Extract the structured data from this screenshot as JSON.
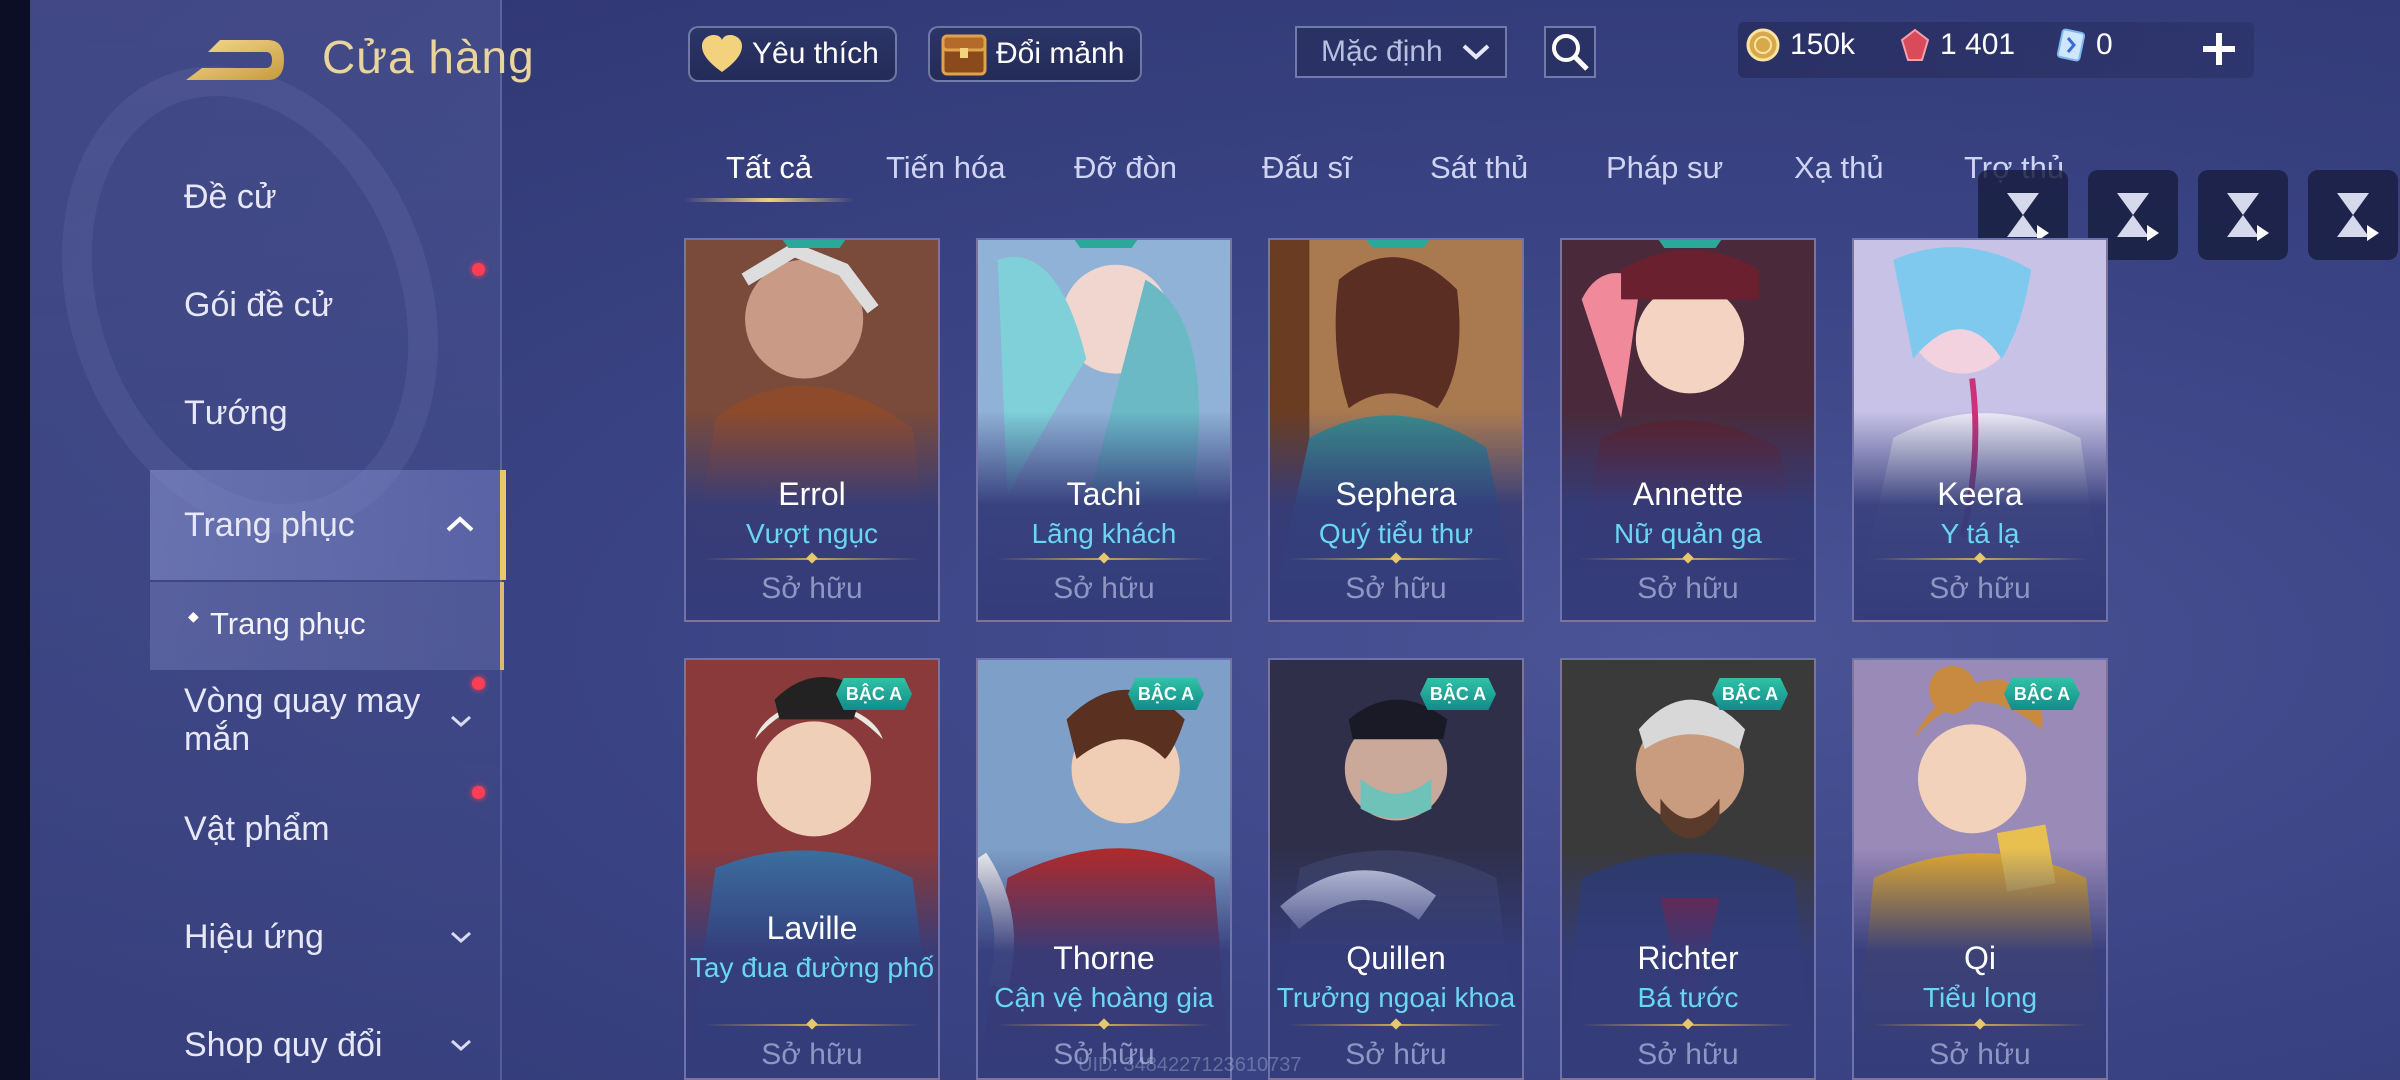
{
  "header": {
    "title": "Cửa hàng",
    "favorites_label": "Yêu thích",
    "exchange_label": "Đổi mảnh",
    "sort_value": "Mặc định"
  },
  "currency": {
    "gold": "150k",
    "vouchers": "1 401",
    "tokens": "0"
  },
  "sidebar": {
    "items": [
      {
        "label": "Đề cử"
      },
      {
        "label": "Gói đề cử"
      },
      {
        "label": "Tướng"
      },
      {
        "label": "Trang phục"
      },
      {
        "label": "Trang phục"
      },
      {
        "label": "Vòng quay may mắn"
      },
      {
        "label": "Vật phẩm"
      },
      {
        "label": "Hiệu ứng"
      },
      {
        "label": "Shop quy đổi"
      }
    ]
  },
  "tabs": [
    "Tất cả",
    "Tiến hóa",
    "Đỡ đòn",
    "Đấu sĩ",
    "Sát thủ",
    "Pháp sư",
    "Xạ thủ",
    "Trợ thủ"
  ],
  "cards": [
    {
      "hero": "Errol",
      "skin": "Vượt ngục",
      "status": "Sở hữu"
    },
    {
      "hero": "Tachi",
      "skin": "Lãng khách",
      "status": "Sở hữu"
    },
    {
      "hero": "Sephera",
      "skin": "Quý tiểu thư",
      "status": "Sở hữu"
    },
    {
      "hero": "Annette",
      "skin": "Nữ quản ga",
      "status": "Sở hữu"
    },
    {
      "hero": "Keera",
      "skin": "Y tá lạ",
      "status": "Sở hữu"
    },
    {
      "hero": "Laville",
      "skin": "Tay đua đường phố",
      "status": "Sở hữu",
      "tier": "BẬC A"
    },
    {
      "hero": "Thorne",
      "skin": "Cận vệ hoàng gia",
      "status": "Sở hữu",
      "tier": "BẬC A"
    },
    {
      "hero": "Quillen",
      "skin": "Trưởng ngoại khoa",
      "status": "Sở hữu",
      "tier": "BẬC A"
    },
    {
      "hero": "Richter",
      "skin": "Bá tước",
      "status": "Sở hữu",
      "tier": "BẬC A"
    },
    {
      "hero": "Qi",
      "skin": "Tiểu long",
      "status": "Sở hữu",
      "tier": "BẬC A"
    }
  ],
  "footer": {
    "uid": "UID: 3484227123610737"
  },
  "colors": {
    "accent_gold": "#e9d49b",
    "skin_cyan": "#69d6f2",
    "badge_teal": "#2fc2a6",
    "notify_red": "#ff3d55"
  }
}
